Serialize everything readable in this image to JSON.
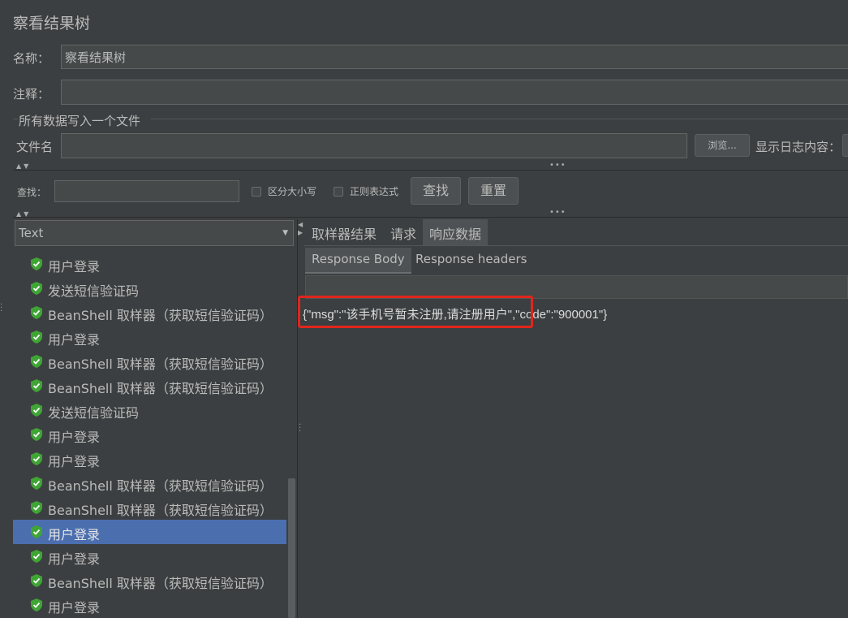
{
  "panel": {
    "title": "察看结果树"
  },
  "name_row": {
    "label": "名称：",
    "value": "察看结果树"
  },
  "comment_row": {
    "label": "注释：",
    "value": ""
  },
  "file_group": {
    "legend": "所有数据写入一个文件",
    "file_label": "文件名",
    "file_value": "",
    "browse_label": "浏览...",
    "log_label": "显示日志内容："
  },
  "search_bar": {
    "label": "查找：",
    "value": "",
    "case_label": "区分大小写",
    "regex_label": "正则表达式",
    "find_label": "查找",
    "reset_label": "重置"
  },
  "renderer": {
    "selected": "Text"
  },
  "tree": {
    "items": [
      {
        "label": "用户登录",
        "status": "success"
      },
      {
        "label": "发送短信验证码",
        "status": "success"
      },
      {
        "label": "BeanShell 取样器（获取短信验证码）",
        "status": "success"
      },
      {
        "label": "用户登录",
        "status": "success"
      },
      {
        "label": "BeanShell 取样器（获取短信验证码）",
        "status": "success"
      },
      {
        "label": "BeanShell 取样器（获取短信验证码）",
        "status": "success"
      },
      {
        "label": "发送短信验证码",
        "status": "success"
      },
      {
        "label": "用户登录",
        "status": "success"
      },
      {
        "label": "用户登录",
        "status": "success"
      },
      {
        "label": "BeanShell 取样器（获取短信验证码）",
        "status": "success"
      },
      {
        "label": "BeanShell 取样器（获取短信验证码）",
        "status": "success"
      },
      {
        "label": "用户登录",
        "status": "success",
        "selected": true
      },
      {
        "label": "用户登录",
        "status": "success"
      },
      {
        "label": "BeanShell 取样器（获取短信验证码）",
        "status": "success"
      },
      {
        "label": "用户登录",
        "status": "success"
      }
    ]
  },
  "result_tabs": {
    "tabs": [
      "取样器结果",
      "请求",
      "响应数据"
    ],
    "active": 2
  },
  "response_tabs": {
    "tabs": [
      "Response Body",
      "Response headers"
    ],
    "active": 0
  },
  "response": {
    "body": "{\"msg\":\"该手机号暂未注册,请注册用户\",\"code\":\"900001\"}"
  },
  "colors": {
    "background": "#3c3f41",
    "selection": "#4b6eaf",
    "success_icon": "#3fa535",
    "highlight_box": "#e0261c"
  }
}
